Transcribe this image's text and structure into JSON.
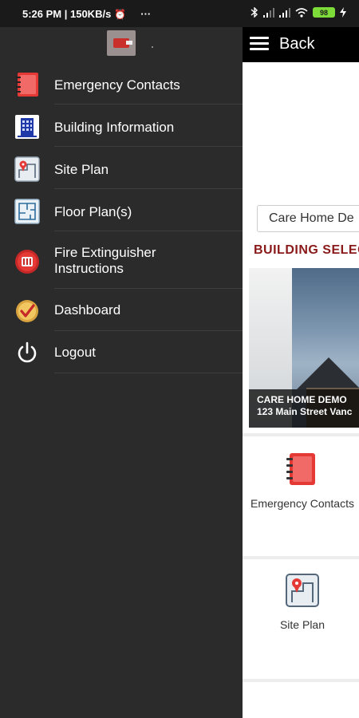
{
  "status_bar": {
    "time_speed": "5:26 PM | 150KB/s",
    "alarm_icon": "⏰",
    "more": "···",
    "battery_level": "98"
  },
  "app_bar": {
    "back_label": "Back"
  },
  "building": {
    "select_value": "Care Home De",
    "heading": "BUILDING SELEC",
    "caption_name": "CARE HOME DEMO",
    "caption_address": "123 Main Street Vanc"
  },
  "tiles": [
    {
      "label": "Emergency Contacts",
      "icon": "address-book-icon"
    },
    {
      "label": "Site Plan",
      "icon": "site-plan-icon"
    }
  ],
  "drawer": {
    "items": [
      {
        "label": "Emergency Contacts",
        "icon": "address-book-icon"
      },
      {
        "label": "Building Information",
        "icon": "building-icon"
      },
      {
        "label": "Site Plan",
        "icon": "site-plan-icon"
      },
      {
        "label": "Floor Plan(s)",
        "icon": "floor-plan-icon"
      },
      {
        "label": "Fire Extinguisher Instructions",
        "icon": "fire-extinguisher-icon"
      },
      {
        "label": "Dashboard",
        "icon": "dashboard-check-icon"
      },
      {
        "label": "Logout",
        "icon": "power-icon"
      }
    ]
  },
  "colors": {
    "drawer_bg": "#2b2b2b",
    "appbar_bg": "#000000",
    "heading_red": "#8a1a1a",
    "accent_red": "#e53935",
    "battery_green": "#7ddc3a"
  }
}
